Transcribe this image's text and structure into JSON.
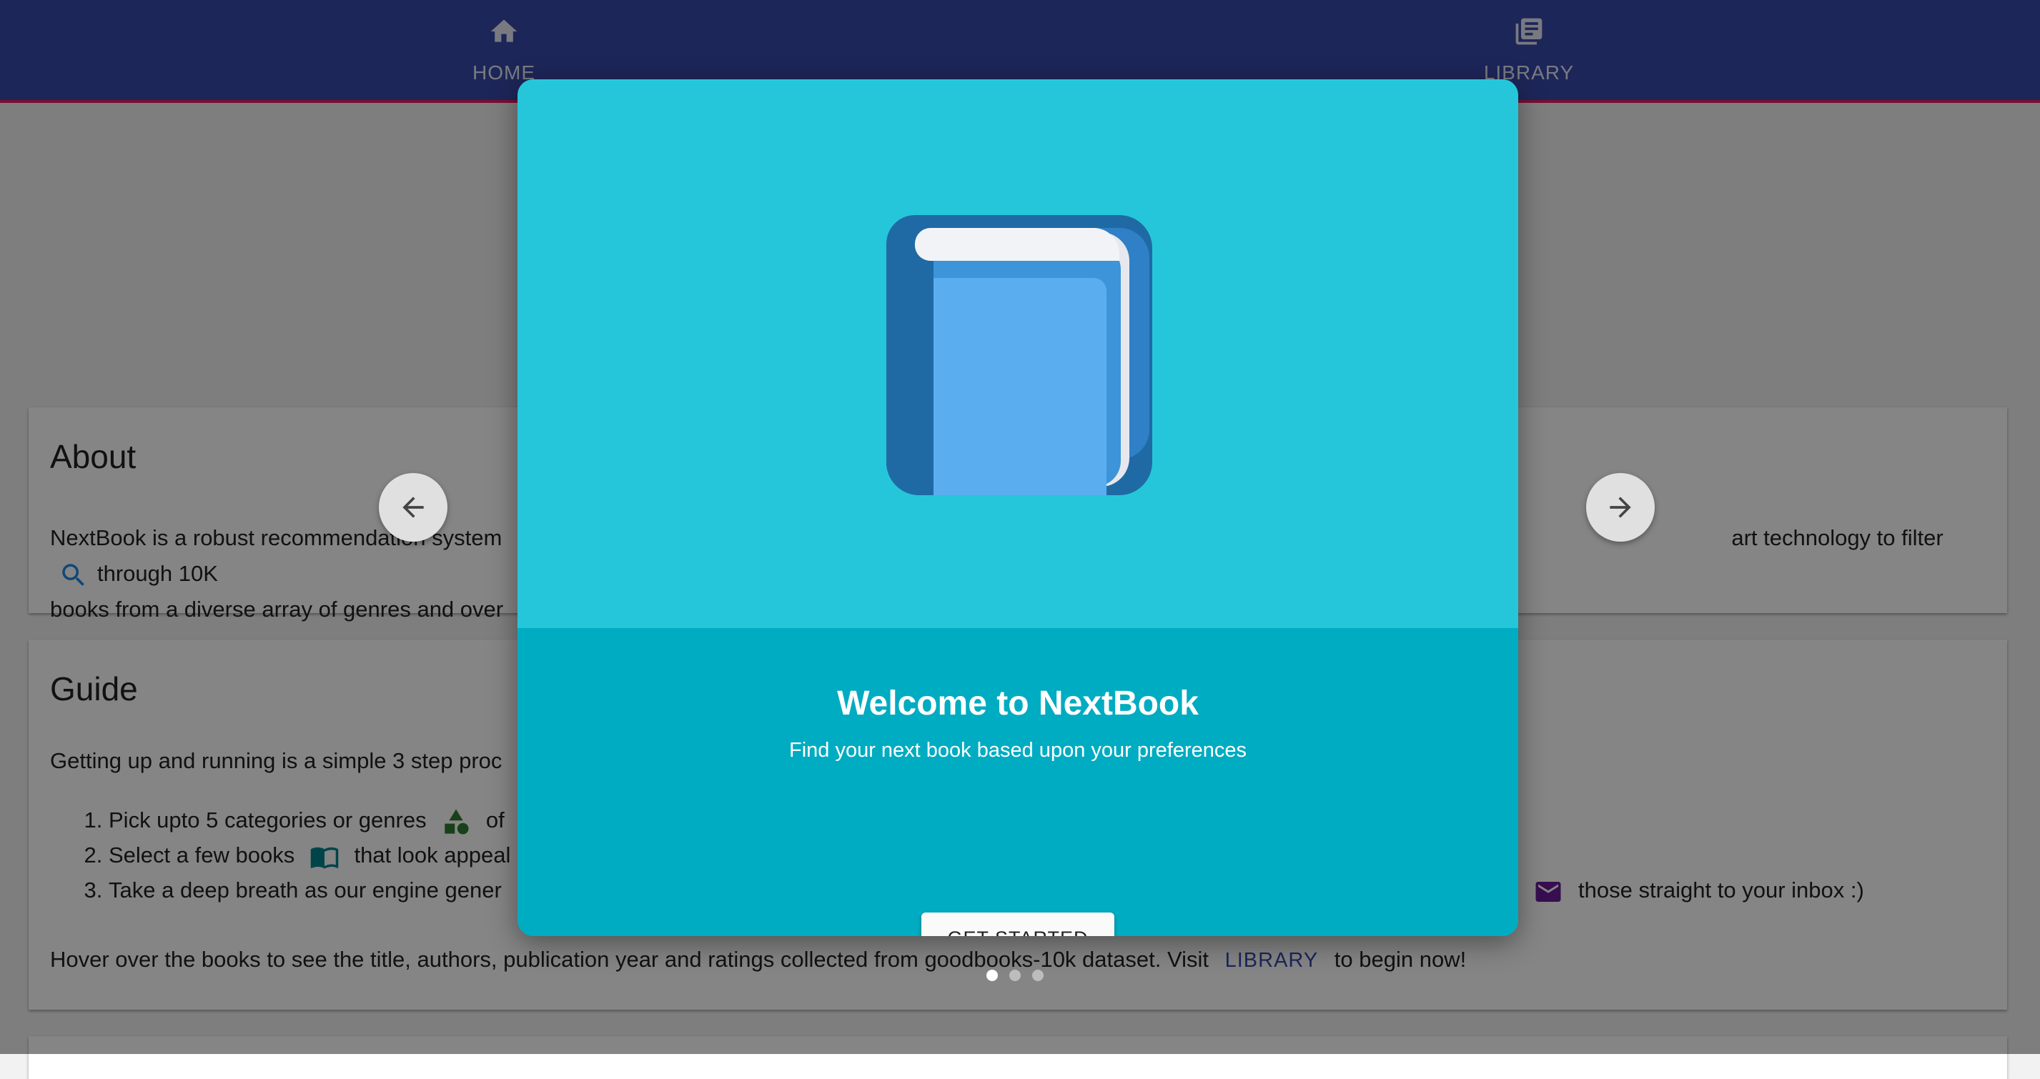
{
  "nav": {
    "home_label": "HOME",
    "library_label": "LIBRARY",
    "home_icon": "home-icon",
    "library_icon": "library-books-icon"
  },
  "about": {
    "title": "About",
    "text_part1": "NextBook is a robust recommendation system",
    "text_part2": "art technology to filter",
    "text_part3": "through 10K",
    "text_line2": "books from a diverse array of genres and over"
  },
  "guide": {
    "title": "Guide",
    "intro": "Getting up and running is a simple 3 step proc",
    "step1_a": "Pick upto 5 categories or genres",
    "step1_b": "of",
    "step2_a": "Select a few books",
    "step2_b": "that look appeal",
    "step3_a": "Take a deep breath as our engine gener",
    "step3_b": "those straight to your inbox :)",
    "hover_a": "Hover over the books to see the title, authors, publication year and ratings collected from goodbooks-10k dataset. Visit",
    "hover_link": "LIBRARY",
    "hover_b": "to begin now!"
  },
  "dialog": {
    "title": "Welcome to NextBook",
    "subtitle": "Find your next book based upon your preferences",
    "button_label": "GET STARTED",
    "illustration": "book-icon"
  },
  "carousel": {
    "total_slides": 3,
    "active_slide": 1
  },
  "colors": {
    "nav_bar": "#3949ab",
    "nav_underline": "#e91e63",
    "dialog_top": "#26c6da",
    "dialog_bottom": "#00acc1"
  }
}
